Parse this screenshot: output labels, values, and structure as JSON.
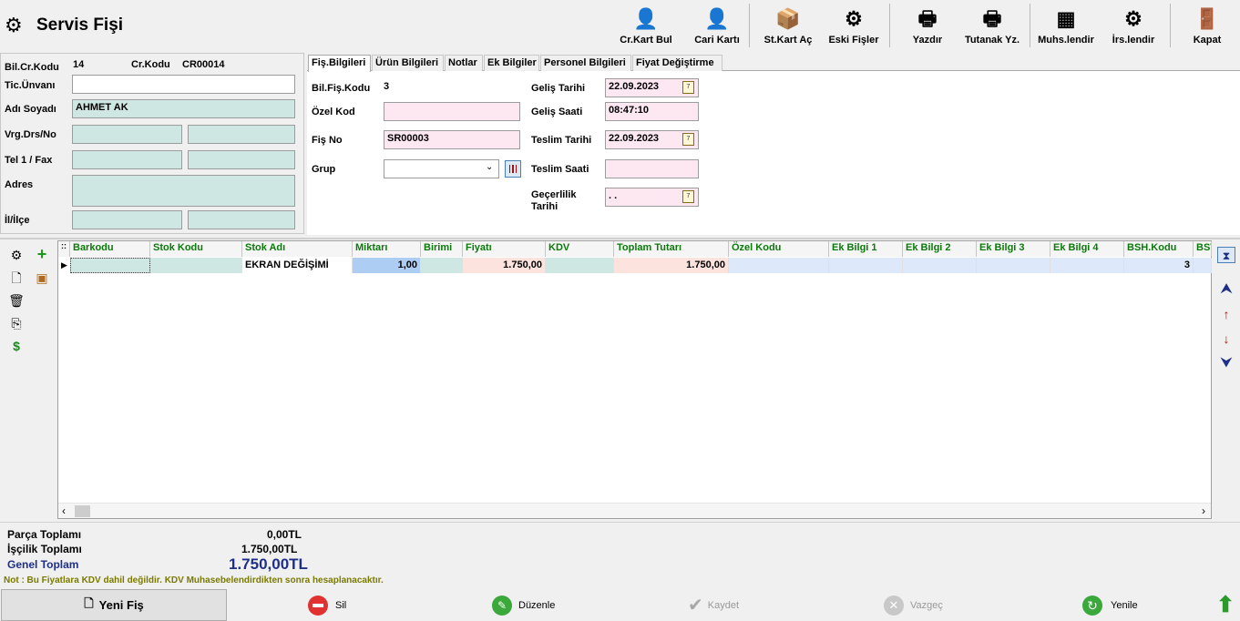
{
  "window": {
    "title": "Servis Fişi"
  },
  "toolbar": [
    {
      "label": "Cr.Kart Bul",
      "icon": "person-search-icon",
      "glyph": "👤"
    },
    {
      "label": "Cari Kartı",
      "icon": "person-add-icon",
      "glyph": "👤"
    },
    {
      "label": "St.Kart Aç",
      "icon": "box-search-icon",
      "glyph": "📦"
    },
    {
      "label": "Eski Fişler",
      "icon": "gears-icon",
      "glyph": "⚙"
    },
    {
      "label": "Yazdır",
      "icon": "printer-icon",
      "glyph": "🖶"
    },
    {
      "label": "Tutanak Yz.",
      "icon": "printer-report-icon",
      "glyph": "🖶"
    },
    {
      "label": "Muhs.lendir",
      "icon": "calculator-icon",
      "glyph": "▦"
    },
    {
      "label": "İrs.lendir",
      "icon": "gears-dispatch-icon",
      "glyph": "⚙"
    },
    {
      "label": "Kapat",
      "icon": "exit-door-icon",
      "glyph": "🚪"
    }
  ],
  "customer": {
    "bil_cr_kodu_label": "Bil.Cr.Kodu",
    "bil_cr_kodu": "14",
    "cr_kodu_label": "Cr.Kodu",
    "cr_kodu": "CR00014",
    "tic_unvani_label": "Tic.Ünvanı",
    "tic_unvani": "",
    "adi_soyadi_label": "Adı Soyadı",
    "adi_soyadi": "AHMET  AK",
    "vrg_label": "Vrg.Drs/No",
    "tel_label": "Tel 1 / Fax",
    "adres_label": "Adres",
    "il_label": "İl/İlçe"
  },
  "tabs": [
    "Fiş.Bilgileri",
    "Ürün Bilgileri",
    "Notlar",
    "Ek Bilgiler",
    "Personel Bilgileri",
    "Fiyat Değiştirme"
  ],
  "fis": {
    "bil_fis_kodu_label": "Bil.Fiş.Kodu",
    "bil_fis_kodu": "3",
    "ozel_kod_label": "Özel Kod",
    "ozel_kod": "",
    "fis_no_label": "Fiş No",
    "fis_no": "SR00003",
    "grup_label": "Grup",
    "grup": "",
    "gelis_tarihi_label": "Geliş Tarihi",
    "gelis_tarihi": "22.09.2023",
    "gelis_saati_label": "Geliş Saati",
    "gelis_saati": "08:47:10",
    "teslim_tarihi_label": "Teslim Tarihi",
    "teslim_tarihi": "22.09.2023",
    "teslim_saati_label": "Teslim Saati",
    "teslim_saati": "",
    "gecerlilik_label_1": "Geçerlilik",
    "gecerlilik_label_2": "Tarihi",
    "gecerlilik_tarihi": ". .",
    "calendar_glyph": "7"
  },
  "grid": {
    "columns": [
      "Barkodu",
      "Stok Kodu",
      "Stok Adı",
      "Miktarı",
      "Birimi",
      "Fiyatı",
      "KDV",
      "Toplam Tutarı",
      "Özel Kodu",
      "Ek Bilgi 1",
      "Ek Bilgi 2",
      "Ek Bilgi 3",
      "Ek Bilgi 4",
      "BSH.Kodu",
      "BST"
    ],
    "rows": [
      [
        "",
        "",
        "EKRAN DEĞİŞİMİ",
        "1,00",
        "",
        "1.750,00",
        "",
        "1.750,00",
        "",
        "",
        "",
        "",
        "",
        "3",
        ""
      ]
    ]
  },
  "totals": {
    "parca_label": "Parça Toplamı",
    "parca": "0,00TL",
    "iscilik_label": "İşçilik Toplamı",
    "iscilik": "1.750,00TL",
    "genel_label": "Genel Toplam",
    "genel": "1.750,00TL",
    "note": "Not  : Bu Fiyatlara KDV dahil değildir. KDV Muhasebelendirdikten sonra hesaplanacaktır."
  },
  "bottom": {
    "yeni": "Yeni Fiş",
    "sil": "Sil",
    "duzenle": "Düzenle",
    "kaydet": "Kaydet",
    "vazgec": "Vazgeç",
    "yenile": "Yenile"
  },
  "colors": {
    "accent_blue": "#1e2f8a",
    "teal_field": "#cfe7e3",
    "pink_field": "#fde8f1",
    "header_green": "#0a7a0a",
    "note_olive": "#7a7a00"
  }
}
